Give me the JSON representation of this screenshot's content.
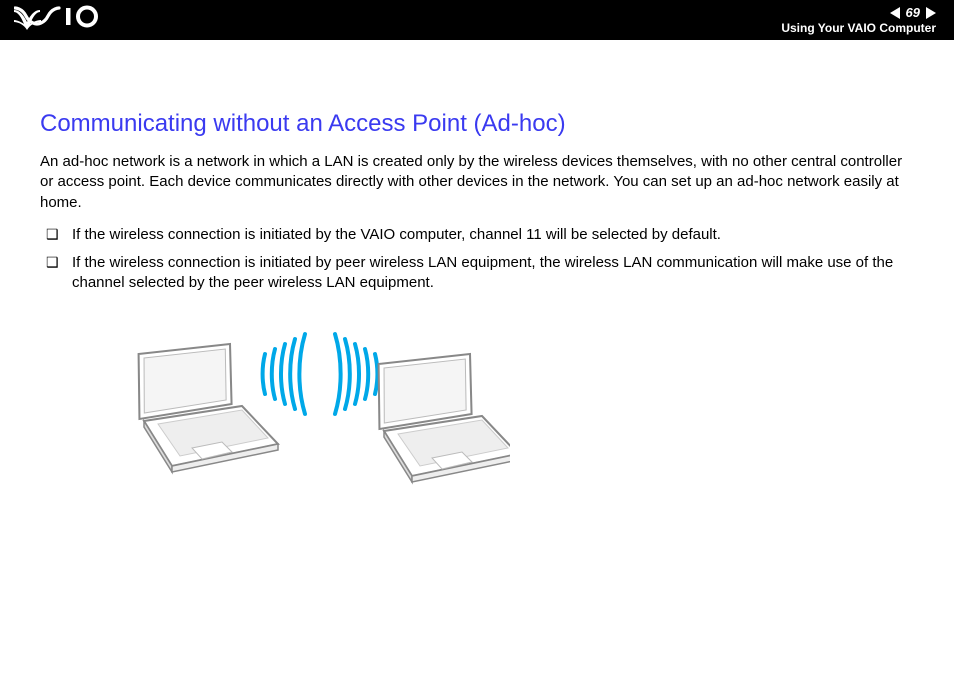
{
  "header": {
    "logo_text": "VAIO",
    "page_number": "69",
    "breadcrumb": "Using Your VAIO Computer"
  },
  "title": "Communicating without an Access Point (Ad-hoc)",
  "intro": "An ad-hoc network is a network in which a LAN is created only by the wireless devices themselves, with no other central controller or access point. Each device communicates directly with other devices in the network. You can set up an ad-hoc network easily at home.",
  "bullets": [
    "If the wireless connection is initiated by the VAIO computer, channel 11 will be selected by default.",
    "If the wireless connection is initiated by peer wireless LAN equipment, the wireless LAN communication will make use of the channel selected by the peer wireless LAN equipment."
  ],
  "illustration": {
    "description": "Two laptop computers communicating directly via wireless signals (ad-hoc)",
    "signal_color": "#00A8E8"
  }
}
